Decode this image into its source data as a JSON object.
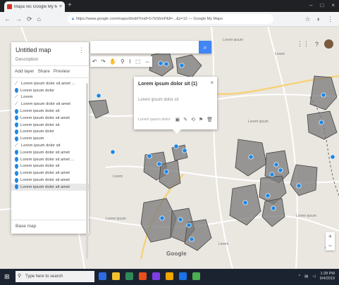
{
  "browser": {
    "tab_title": "Mapa rec Google My Ma...",
    "tab_close": "×",
    "new_tab": "+",
    "url": "https://www.google.com/maps/d/edit?mid=1i7kS6mP&ll=...&z=12 — Google My Maps",
    "window_controls": [
      "–",
      "□",
      "×"
    ],
    "nav": [
      "←",
      "→",
      "⟳",
      "⌂"
    ],
    "ext_icons": [
      "☆",
      "◐",
      "⋮"
    ]
  },
  "map_panel": {
    "title": "Untitled map",
    "description": "Description",
    "more": "⋮",
    "actions": [
      "Add layer",
      "Share",
      "Preview"
    ],
    "layer_items": [
      {
        "type": "line",
        "label": "Lorem ipsum dolor sit amet ..."
      },
      {
        "type": "pin",
        "label": "Lorem ipsum dolor"
      },
      {
        "type": "line",
        "label": "Lorem"
      },
      {
        "type": "line",
        "label": "Lorem ipsum dolor sit amet"
      },
      {
        "type": "pin",
        "label": "Lorem ipsum dolor sit"
      },
      {
        "type": "pin",
        "label": "Lorem ipsum dolor sit amet"
      },
      {
        "type": "pin",
        "label": "Lorem ipsum dolor sit"
      },
      {
        "type": "pin",
        "label": "Lorem ipsum dolor"
      },
      {
        "type": "pin",
        "label": "Lorem ipsum"
      },
      {
        "type": "line",
        "label": "Lorem ipsum dolor sit"
      },
      {
        "type": "pin",
        "label": "Lorem ipsum dolor sit amet"
      },
      {
        "type": "pin",
        "label": "Lorem ipsum dolor sit amet ..."
      },
      {
        "type": "pin",
        "label": "Lorem ipsum dolor sit"
      },
      {
        "type": "pin",
        "label": "Lorem ipsum dolor sit amet"
      },
      {
        "type": "pin",
        "label": "Lorem ipsum dolor sit amet"
      },
      {
        "type": "pin",
        "label": "Lorem ipsum dolor sit amet",
        "selected": true
      }
    ],
    "footer": "Base map"
  },
  "search": {
    "placeholder": "",
    "button": "⌕"
  },
  "toolbar_icons": [
    "↶",
    "↷",
    "✋",
    "⚲",
    "⌇",
    "⬚",
    "⇔"
  ],
  "info_window": {
    "title": "Lorem ipsum dolor sit (1)",
    "close": "×",
    "body": "Lorem ipsum dolor sit",
    "address": "Lorem ipsum dolor",
    "icons": [
      "▣",
      "✎",
      "⟲",
      "⚑",
      "🗑"
    ]
  },
  "map_controls": {
    "apps": "⋮⋮",
    "help": "?"
  },
  "zoom": {
    "plus": "+",
    "minus": "−"
  },
  "google_logo": "Google",
  "map_labels": [
    "Lorem ipsum",
    "Lorem",
    "Lorem ipsum",
    "Lorem",
    "Lorem ipsum",
    "Lorem",
    "Lorem ipsum"
  ],
  "taskbar": {
    "start": "⊞",
    "search_placeholder": "Type here to search",
    "apps": [
      "#2d6be4",
      "#f2c12e",
      "#2e8b57",
      "#e94e1b",
      "#7b3fe4",
      "#f0a500",
      "#1a73e8",
      "#4caf50"
    ],
    "time": "1:28 PM",
    "date": "9/4/2019"
  }
}
